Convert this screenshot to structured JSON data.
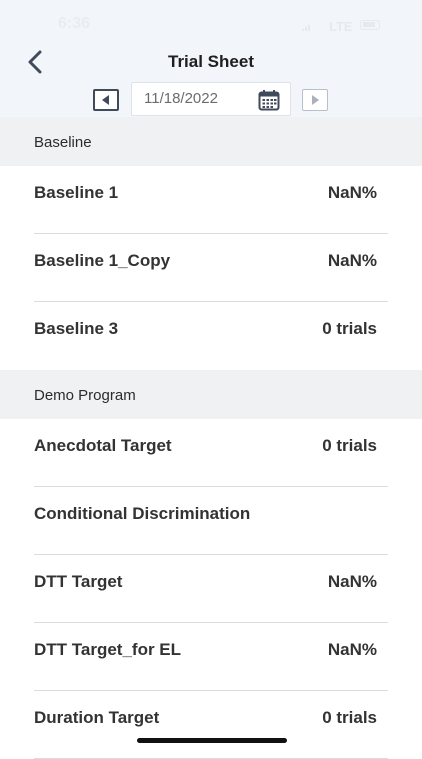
{
  "status_bar": {
    "time": "6:36",
    "network": "LTE"
  },
  "header": {
    "title": "Trial Sheet",
    "date_value": "11/18/2022",
    "accent_color": "#3f4a5b"
  },
  "icons": {
    "back": "chevron-left-icon",
    "prev": "triangle-left-icon",
    "next": "triangle-right-icon",
    "calendar": "calendar-icon"
  },
  "sections": [
    {
      "title": "Baseline",
      "rows": [
        {
          "label": "Baseline 1",
          "value": "NaN%"
        },
        {
          "label": "Baseline 1_Copy",
          "value": "NaN%"
        },
        {
          "label": "Baseline 3",
          "value": "0 trials"
        }
      ]
    },
    {
      "title": "Demo Program",
      "rows": [
        {
          "label": "Anecdotal Target",
          "value": "0 trials"
        },
        {
          "label": "Conditional Discrimination",
          "value": ""
        },
        {
          "label": "DTT Target",
          "value": "NaN%"
        },
        {
          "label": "DTT Target_for EL",
          "value": "NaN%"
        },
        {
          "label": "Duration Target",
          "value": "0 trials"
        }
      ]
    }
  ]
}
